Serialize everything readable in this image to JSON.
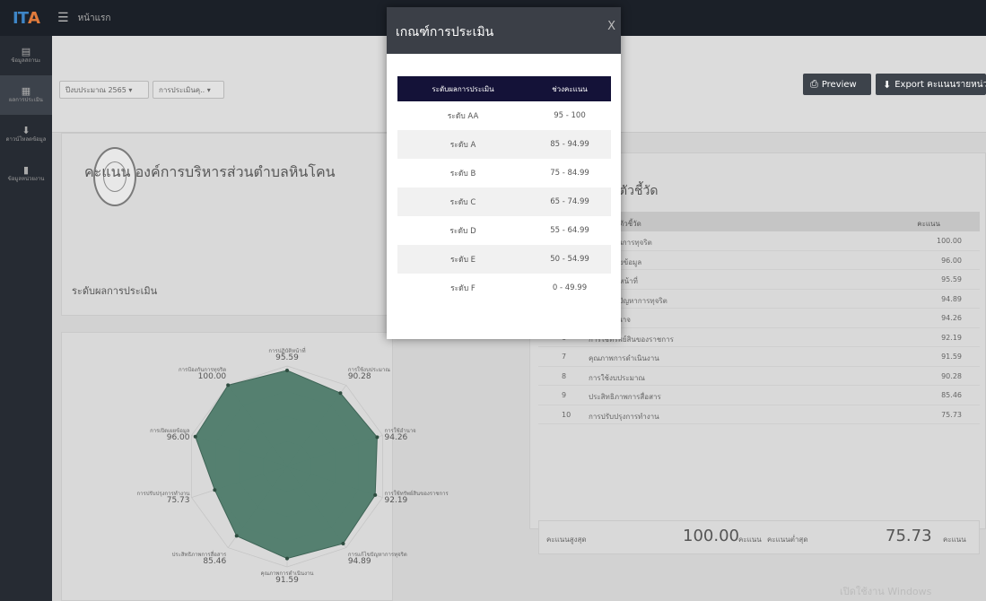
{
  "topbar": {
    "logo_a": "IT",
    "logo_b": "A",
    "menu_icon": "☰",
    "breadcrumb": "หน้าแรก"
  },
  "sidebar": {
    "items": [
      {
        "icon": "chart-icon",
        "glyph": "▤",
        "label": "ข้อมูลสถานะ"
      },
      {
        "icon": "doc-icon",
        "glyph": "▦",
        "label": "ผลการประเมิน"
      },
      {
        "icon": "download-icon",
        "glyph": "⬇",
        "label": "ดาวน์โหลดข้อมูล"
      },
      {
        "icon": "file-icon",
        "glyph": "▮",
        "label": "ข้อมูลหน่วยงาน"
      }
    ]
  },
  "filters": {
    "year": "ปีงบประมาณ 2565 ▾",
    "type": "การประเมินคุ.. ▾"
  },
  "buttons": {
    "preview": "Preview",
    "export": "Export คะแนนรายหน่วยงาน"
  },
  "score": {
    "title": "คะแนน องค์การบริหารส่วนตำบลหินโคน",
    "level_label": "ระดับผลการประเมิน"
  },
  "radar": {
    "labels": [
      {
        "name": "การปฏิบัติหน้าที่",
        "value": "95.59"
      },
      {
        "name": "การใช้งบประมาณ",
        "value": "90.28"
      },
      {
        "name": "การใช้อำนาจ",
        "value": "94.26"
      },
      {
        "name": "การใช้ทรัพย์สินของราชการ",
        "value": "92.19"
      },
      {
        "name": "การแก้ไขปัญหาการทุจริต",
        "value": "94.89"
      },
      {
        "name": "คุณภาพการดำเนินงาน",
        "value": "91.59"
      },
      {
        "name": "ประสิทธิภาพการสื่อสาร",
        "value": "85.46"
      },
      {
        "name": "การปรับปรุงการทำงาน",
        "value": "75.73"
      },
      {
        "name": "การเปิดเผยข้อมูล",
        "value": "96.00"
      },
      {
        "name": "การป้องกันการทุจริต",
        "value": "100.00"
      }
    ],
    "fill": "#4e7b6a"
  },
  "indicators": {
    "title": "ตัวชี้วัด",
    "col_name": "ตัวชี้วัด",
    "col_score": "คะแนน",
    "rows": [
      {
        "no": "",
        "name": "การป้องกันการทุจริต",
        "score": "100.00"
      },
      {
        "no": "",
        "name": "การเปิดเผยข้อมูล",
        "score": "96.00"
      },
      {
        "no": "",
        "name": "การปฏิบัติหน้าที่",
        "score": "95.59"
      },
      {
        "no": "",
        "name": "การแก้ไขปัญหาการทุจริต",
        "score": "94.89"
      },
      {
        "no": "5",
        "name": "การใช้อำนาจ",
        "score": "94.26"
      },
      {
        "no": "6",
        "name": "การใช้ทรัพย์สินของราชการ",
        "score": "92.19"
      },
      {
        "no": "7",
        "name": "คุณภาพการดำเนินงาน",
        "score": "91.59"
      },
      {
        "no": "8",
        "name": "การใช้งบประมาณ",
        "score": "90.28"
      },
      {
        "no": "9",
        "name": "ประสิทธิภาพการสื่อสาร",
        "score": "85.46"
      },
      {
        "no": "10",
        "name": "การปรับปรุงการทำงาน",
        "score": "75.73"
      }
    ]
  },
  "summary": {
    "max_label": "คะแนนสูงสุด",
    "max_value": "100.00",
    "min_label": "คะแนนต่ำสุด",
    "min_value": "75.73",
    "unit": "คะแนน"
  },
  "watermark": "เปิดใช้งาน Windows",
  "modal": {
    "title": "เกณฑ์การประเมิน",
    "close": "X",
    "headers": [
      "ระดับผลการประเมิน",
      "ช่วงคะแนน"
    ],
    "rows": [
      {
        "level": "ระดับ AA",
        "range": "95 - 100"
      },
      {
        "level": "ระดับ A",
        "range": "85 - 94.99"
      },
      {
        "level": "ระดับ B",
        "range": "75 - 84.99"
      },
      {
        "level": "ระดับ C",
        "range": "65 - 74.99"
      },
      {
        "level": "ระดับ D",
        "range": "55 - 64.99"
      },
      {
        "level": "ระดับ E",
        "range": "50 - 54.99"
      },
      {
        "level": "ระดับ F",
        "range": "0 - 49.99"
      }
    ]
  }
}
